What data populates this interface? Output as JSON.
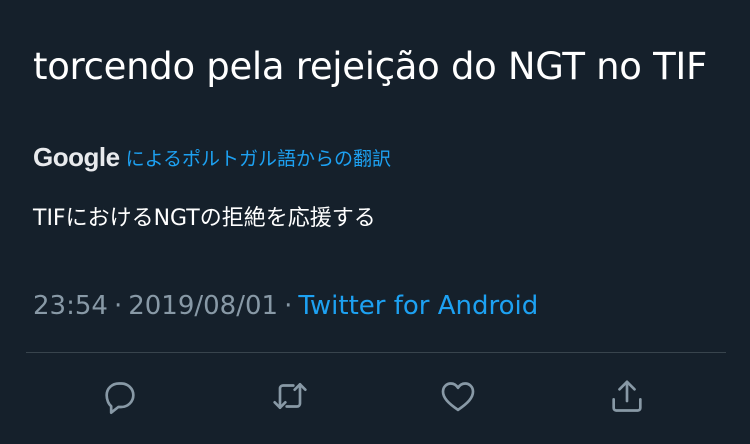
{
  "tweet": {
    "text": "torcendo pela rejeição do NGT no TIF"
  },
  "translation": {
    "provider_logo_text": "Google",
    "label": "によるポルトガル語からの翻訳",
    "translated_text": "TIFにおけるNGTの拒絶を応援する"
  },
  "meta": {
    "time": "23:54",
    "separator": "·",
    "date": "2019/08/01",
    "source": "Twitter for Android"
  },
  "actions": [
    {
      "name": "reply",
      "icon": "reply-icon"
    },
    {
      "name": "retweet",
      "icon": "retweet-icon"
    },
    {
      "name": "like",
      "icon": "heart-icon"
    },
    {
      "name": "share",
      "icon": "share-icon"
    }
  ],
  "colors": {
    "background": "#15202b",
    "text": "#ffffff",
    "secondary_text": "#8899a6",
    "accent": "#1da1f2",
    "divider": "#38444d"
  }
}
